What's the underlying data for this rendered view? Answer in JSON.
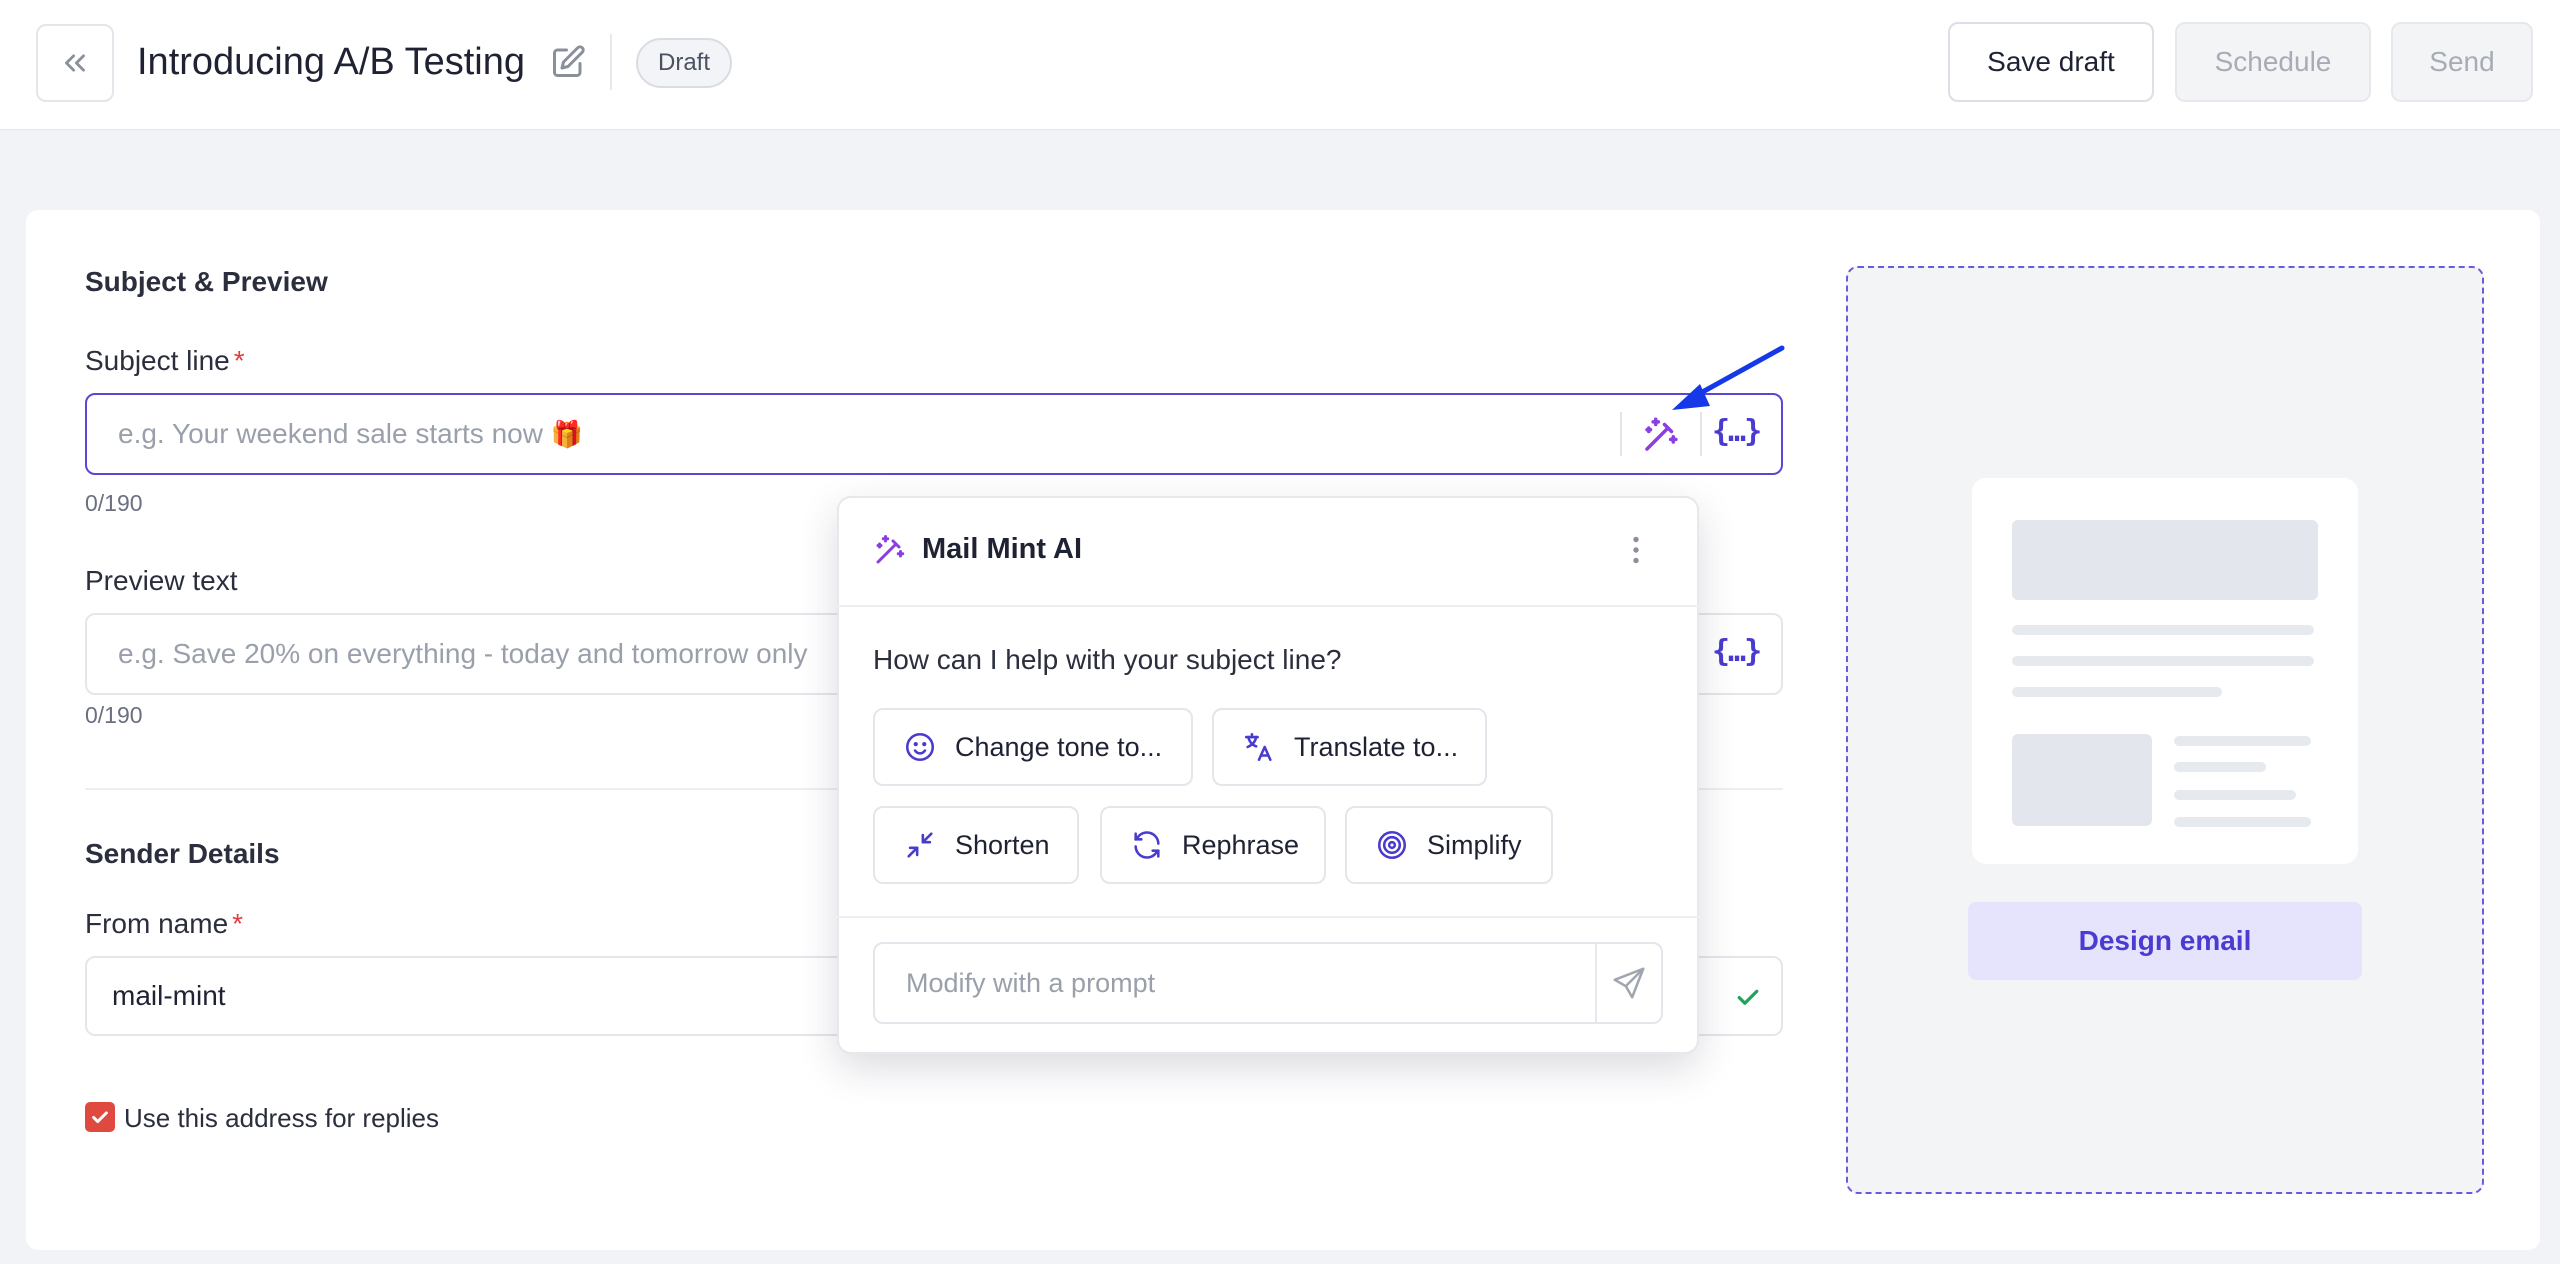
{
  "header": {
    "title": "Introducing A/B Testing",
    "status_badge": "Draft",
    "save_draft_label": "Save draft",
    "schedule_label": "Schedule",
    "send_label": "Send"
  },
  "subject_preview": {
    "section_title": "Subject & Preview",
    "subject_label": "Subject line",
    "required_mark": "*",
    "subject_placeholder": "e.g. Your weekend sale starts now",
    "subject_emoji": "🎁",
    "subject_counter": "0/190",
    "preview_label": "Preview text",
    "preview_placeholder": "e.g. Save 20% on everything - today and tomorrow only",
    "preview_counter": "0/190",
    "variable_token": "{…}"
  },
  "sender": {
    "section_title": "Sender Details",
    "from_label": "From name",
    "required_mark": "*",
    "from_value": "mail-mint",
    "reply_checkbox_label": "Use this address for replies",
    "reply_checked": true
  },
  "design": {
    "button_label": "Design email"
  },
  "ai_popover": {
    "title": "Mail Mint AI",
    "question": "How can I help with your subject line?",
    "actions": [
      {
        "label": "Change tone to...",
        "icon": "smile-icon"
      },
      {
        "label": "Translate to...",
        "icon": "translate-icon"
      },
      {
        "label": "Shorten",
        "icon": "shrink-icon"
      },
      {
        "label": "Rephrase",
        "icon": "refresh-icon"
      },
      {
        "label": "Simplify",
        "icon": "target-icon"
      }
    ],
    "prompt_placeholder": "Modify with a prompt"
  },
  "colors": {
    "accent": "#5b47d6",
    "required": "#e03e3e",
    "checkbox": "#e0493f",
    "success": "#22a35a",
    "annotation_arrow": "#1538e8"
  }
}
